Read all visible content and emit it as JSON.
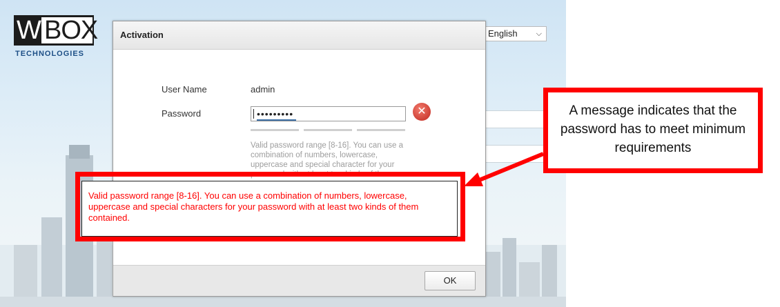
{
  "brand": {
    "logo_letter": "W",
    "logo_rest": "BOX",
    "logo_subtitle": "TECHNOLOGIES"
  },
  "language": {
    "selected": "English"
  },
  "dialog": {
    "title": "Activation",
    "username_label": "User Name",
    "username_value": "admin",
    "password_label": "Password",
    "password_value": "•••••••••",
    "error_icon": "close-error-icon",
    "hint": "Valid password range [8-16]. You can use a combination of numbers, lowercase, uppercase and special character for your password with at least two kinds of them",
    "ok_label": "OK"
  },
  "callout": {
    "text": "Valid password range [8-16]. You can use a combination of numbers, lowercase, uppercase and special characters for your password with at least two kinds of them contained."
  },
  "note": {
    "text": "A message indicates that the password has to meet minimum requirements"
  },
  "colors": {
    "annotation_red": "#ff0000",
    "error_red": "#c0281f"
  }
}
